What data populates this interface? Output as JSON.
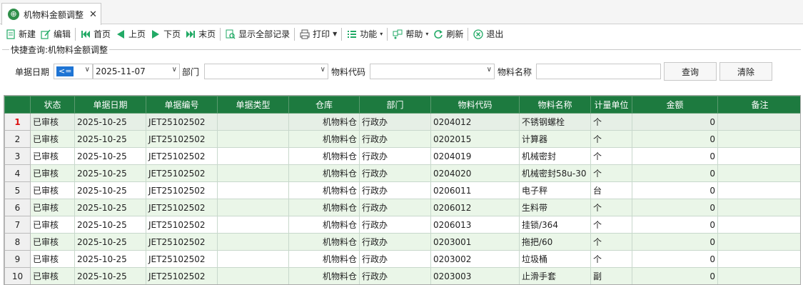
{
  "tab": {
    "title": "机物料金额调整",
    "close": "✕"
  },
  "toolbar": {
    "new": "新建",
    "edit": "编辑",
    "first": "首页",
    "prev": "上页",
    "next": "下页",
    "last": "末页",
    "show_all": "显示全部记录",
    "print": "打印",
    "function": "功能",
    "help": "帮助",
    "refresh": "刷新",
    "exit": "退出"
  },
  "query": {
    "legend": "快捷查询:机物料金额调整",
    "date_label": "单据日期",
    "operator": "<=",
    "date_value": "2025-11-07",
    "dept_label": "部门",
    "dept_value": "",
    "code_label": "物料代码",
    "code_value": "",
    "name_label": "物料名称",
    "name_value": "",
    "search_button": "查询",
    "clear_button": "清除"
  },
  "grid": {
    "columns": [
      "状态",
      "单据日期",
      "单据编号",
      "单据类型",
      "仓库",
      "部门",
      "物料代码",
      "物料名称",
      "计量单位",
      "金额",
      "备注"
    ],
    "rows": [
      [
        "1",
        "已审核",
        "2025-10-25",
        "JET25102502",
        "",
        "机物料仓",
        "行政办",
        "0204012",
        "不锈钢螺栓",
        "个",
        "0",
        ""
      ],
      [
        "2",
        "已审核",
        "2025-10-25",
        "JET25102502",
        "",
        "机物料仓",
        "行政办",
        "0202015",
        "计算器",
        "个",
        "0",
        ""
      ],
      [
        "3",
        "已审核",
        "2025-10-25",
        "JET25102502",
        "",
        "机物料仓",
        "行政办",
        "0204019",
        "机械密封",
        "个",
        "0",
        ""
      ],
      [
        "4",
        "已审核",
        "2025-10-25",
        "JET25102502",
        "",
        "机物料仓",
        "行政办",
        "0204020",
        "机械密封58u-30",
        "个",
        "0",
        ""
      ],
      [
        "5",
        "已审核",
        "2025-10-25",
        "JET25102502",
        "",
        "机物料仓",
        "行政办",
        "0206011",
        "电子秤",
        "台",
        "0",
        ""
      ],
      [
        "6",
        "已审核",
        "2025-10-25",
        "JET25102502",
        "",
        "机物料仓",
        "行政办",
        "0206012",
        "生料带",
        "个",
        "0",
        ""
      ],
      [
        "7",
        "已审核",
        "2025-10-25",
        "JET25102502",
        "",
        "机物料仓",
        "行政办",
        "0206013",
        "挂锁/364",
        "个",
        "0",
        ""
      ],
      [
        "8",
        "已审核",
        "2025-10-25",
        "JET25102502",
        "",
        "机物料仓",
        "行政办",
        "0203001",
        "拖把/60",
        "个",
        "0",
        ""
      ],
      [
        "9",
        "已审核",
        "2025-10-25",
        "JET25102502",
        "",
        "机物料仓",
        "行政办",
        "0203002",
        "垃圾桶",
        "个",
        "0",
        ""
      ],
      [
        "10",
        "已审核",
        "2025-10-25",
        "JET25102502",
        "",
        "机物料仓",
        "行政办",
        "0203003",
        "止滑手套",
        "副",
        "0",
        ""
      ]
    ]
  },
  "colors": {
    "header_bg": "#1d7a3f",
    "alt_row": "#eaf6e8",
    "accent": "#1e74d4"
  }
}
